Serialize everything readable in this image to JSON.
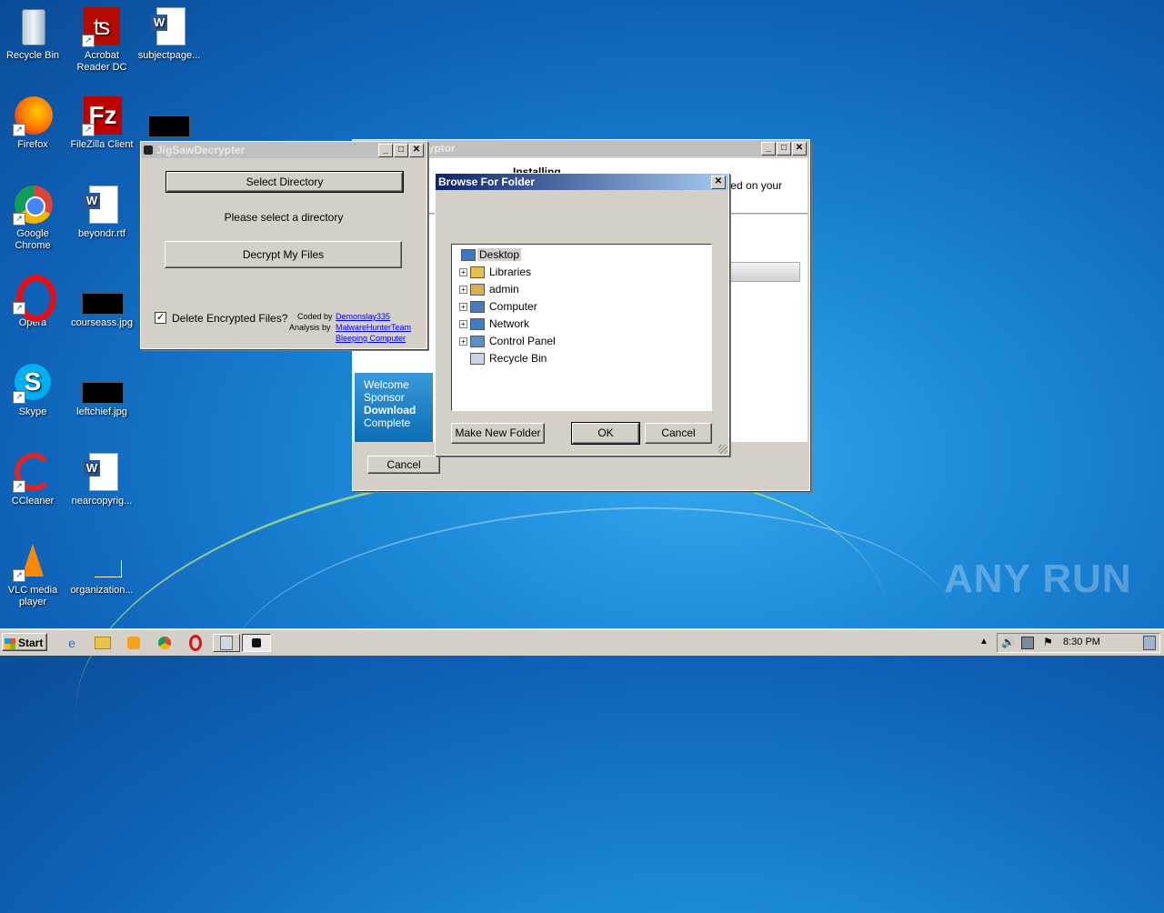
{
  "desktop": {
    "icons": [
      {
        "label": "Recycle Bin"
      },
      {
        "label": "Acrobat Reader DC"
      },
      {
        "label": "subjectpage..."
      },
      {
        "label": "Firefox"
      },
      {
        "label": "FileZilla Client"
      },
      {
        "label": "Google Chrome"
      },
      {
        "label": "beyondr.rtf"
      },
      {
        "label": "Opera"
      },
      {
        "label": "courseass.jpg"
      },
      {
        "label": "Skype"
      },
      {
        "label": "leftchief.jpg"
      },
      {
        "label": "CCleaner"
      },
      {
        "label": "nearcopyrig..."
      },
      {
        "label": "VLC media player"
      },
      {
        "label": "organization..."
      }
    ]
  },
  "installer": {
    "title": "ryptor",
    "heading": "Installing",
    "text": "lled on your",
    "side": {
      "l1": "Welcome",
      "l2": "Sponsor",
      "l3": "Download",
      "l4": "Complete"
    },
    "cancel": "Cancel"
  },
  "jigsaw": {
    "title": "JigSawDecrypter",
    "select_dir": "Select Directory",
    "status": "Please select a directory",
    "decrypt": "Decrypt My Files",
    "delete_label": "Delete Encrypted Files?",
    "delete_checked": true,
    "coded_by": "Coded by",
    "coded_by_link": "Demonslay335",
    "analysis_by": "Analysis by",
    "analysis_link": "MalwareHunterTeam",
    "bleeping_link": "Bleeping Computer"
  },
  "browse": {
    "title": "Browse For Folder",
    "tree": [
      {
        "label": "Desktop"
      },
      {
        "label": "Libraries"
      },
      {
        "label": "admin"
      },
      {
        "label": "Computer"
      },
      {
        "label": "Network"
      },
      {
        "label": "Control Panel"
      },
      {
        "label": "Recycle Bin"
      }
    ],
    "new_folder": "Make New Folder",
    "ok": "OK",
    "cancel": "Cancel"
  },
  "taskbar": {
    "start": "Start",
    "clock": "8:30 PM"
  },
  "watermark": "ANY RUN"
}
